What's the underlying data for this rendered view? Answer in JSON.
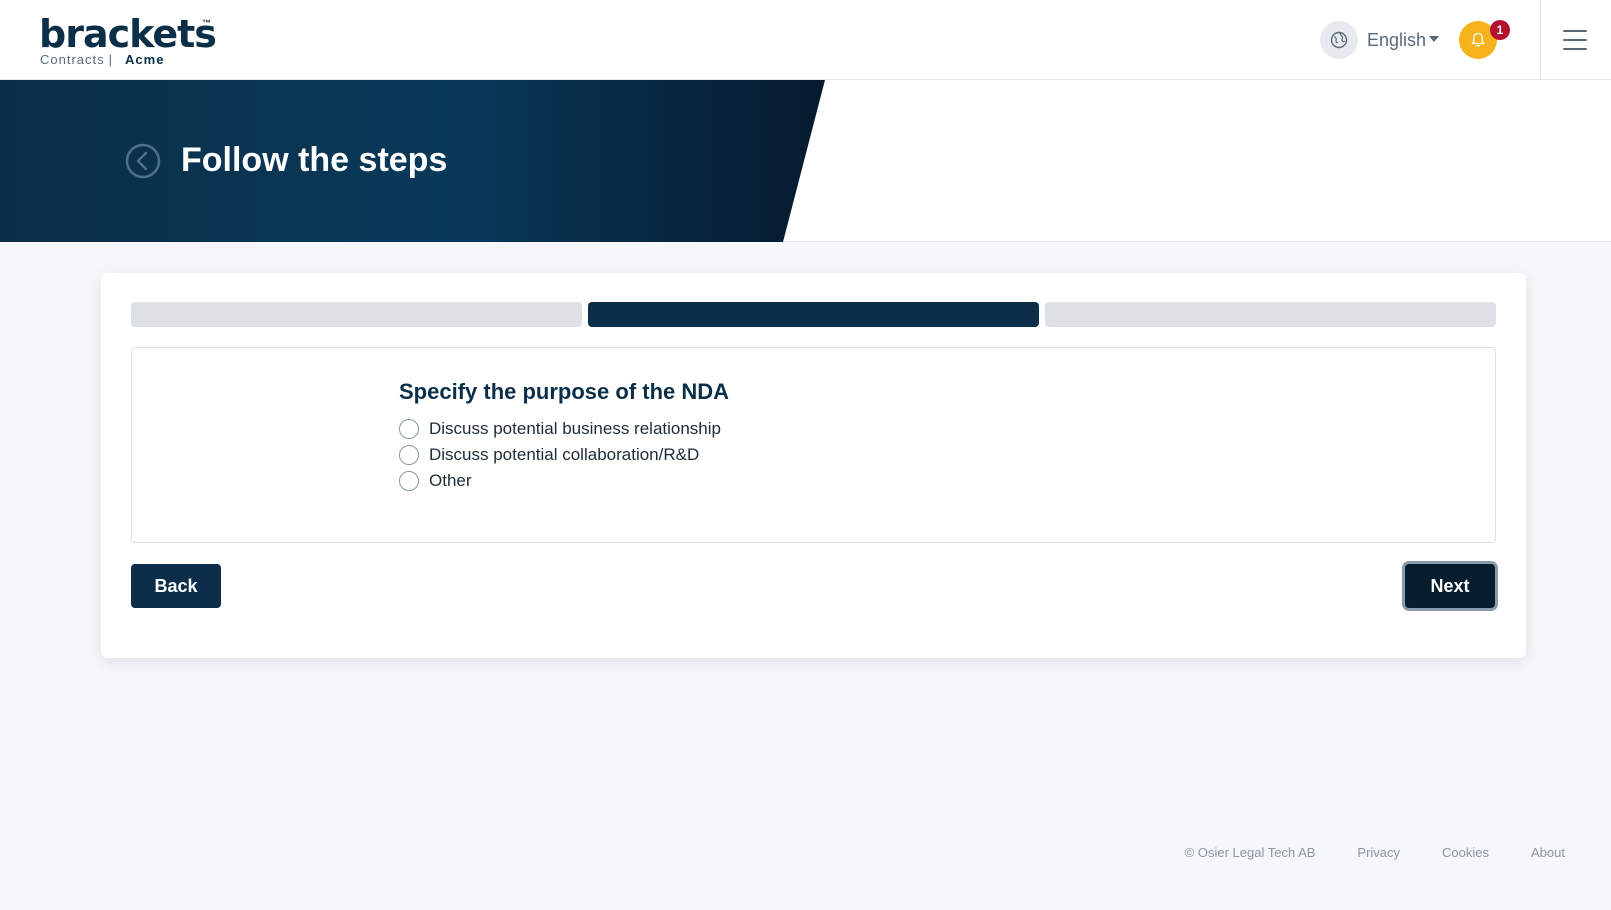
{
  "header": {
    "logo": {
      "word": "brackets",
      "tm": "™",
      "product": "Contracts",
      "separator": "|",
      "org": "Acme"
    },
    "language": {
      "selected": "English"
    },
    "notifications": {
      "count": "1"
    }
  },
  "hero": {
    "title": "Follow the steps"
  },
  "wizard": {
    "steps": [
      {
        "state": "inactive"
      },
      {
        "state": "active"
      },
      {
        "state": "inactive"
      }
    ],
    "question": "Specify the purpose of the NDA",
    "options": [
      "Discuss potential business relationship",
      "Discuss potential collaboration/R&D",
      "Other"
    ],
    "back_label": "Back",
    "next_label": "Next"
  },
  "footer": {
    "copyright": "© Osier Legal Tech AB",
    "privacy": "Privacy",
    "cookies": "Cookies",
    "about": "About"
  },
  "colors": {
    "brand_navy": "#0b2f49",
    "notification_yellow": "#f6b21b",
    "badge_red": "#b3122e",
    "step_inactive": "#dde1e6"
  },
  "icons": {
    "language": "globe-icon",
    "notifications": "bell-icon",
    "menu": "hamburger-icon",
    "back": "chevron-left-circle-icon"
  }
}
